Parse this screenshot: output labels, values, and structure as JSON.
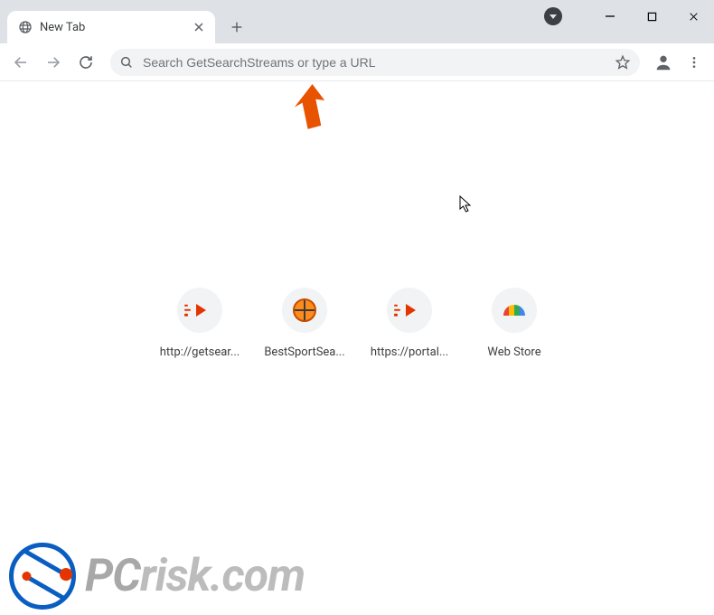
{
  "window": {
    "tab_title": "New Tab"
  },
  "toolbar": {
    "search_placeholder": "Search GetSearchStreams or type a URL"
  },
  "shortcuts": [
    {
      "label": "http://getsear...",
      "icon": "play"
    },
    {
      "label": "BestSportSea...",
      "icon": "ball"
    },
    {
      "label": "https://portal...",
      "icon": "play"
    },
    {
      "label": "Web Store",
      "icon": "rainbow"
    }
  ],
  "watermark": {
    "prefix": "PC",
    "suffix": "risk.com"
  }
}
